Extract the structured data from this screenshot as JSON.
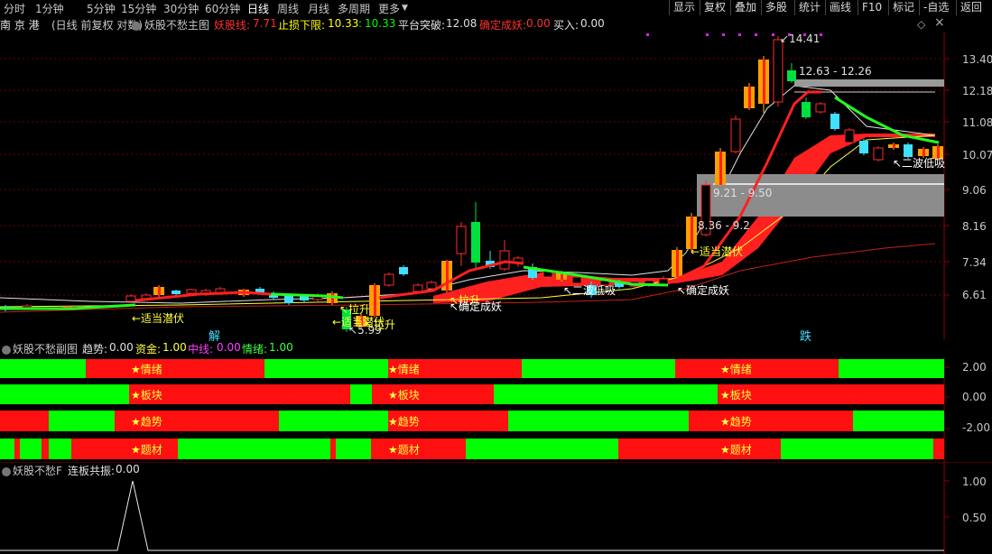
{
  "periods": [
    "分时",
    "1分钟",
    "5分钟",
    "15分钟",
    "30分钟",
    "60分钟",
    "日线",
    "周线",
    "月线",
    "多周期",
    "更多"
  ],
  "active_period": "日线",
  "right_buttons": [
    "显示",
    "复权",
    "叠加",
    "多股",
    "统计",
    "画线",
    "F10",
    "标记",
    "-自选",
    "返回"
  ],
  "stock": {
    "name": "南 京 港",
    "mode": "(日线 前复权 对数)",
    "indicator_main": "妖股不愁主图",
    "yaoguxian_label": "妖股线:",
    "yaoguxian_value": "7.71",
    "stoploss_label": "止损下限:",
    "stoploss_value1": "10.33",
    "stoploss_value2": "10.33",
    "platform_label": "平台突破:",
    "platform_value": "12.08",
    "confirm_label": "确定成妖:",
    "confirm_value": "0.00",
    "buy_label": "买入:",
    "buy_value": "0.00"
  },
  "main_y_labels": [
    "13.40",
    "12.18",
    "11.08",
    "10.07",
    "9.06",
    "8.16",
    "7.34",
    "6.61"
  ],
  "annotations": {
    "high_price": "14.41",
    "range1": "12.63 - 12.26",
    "range2": "9.21 - 9.50",
    "range3": "8.36 - 9.2",
    "low_price": "5.99",
    "sig_latent1": "←适当潜伏",
    "sig_latent2": "←适当潜伏",
    "sig_latent3": "←适当潜伏",
    "sig_pull": "↖拉升",
    "sig_pull2": "↖拉升",
    "sig_confirm1": "↖确定成妖",
    "sig_confirm2": "↖确定成妖",
    "sig_second_wave": "↖二波低吸",
    "sig_second_wave2": "↖二波低吸",
    "marker_jie": "解",
    "marker_die": "跌"
  },
  "sub1": {
    "title": "妖股不愁副图",
    "trend_label": "趋势:",
    "trend_value": "0.00",
    "fund_label": "资金:",
    "fund_value": "1.00",
    "mid_label": "中线:",
    "mid_value": "0.00",
    "mood_label": "情绪:",
    "mood_value": "1.00",
    "y_labels": [
      "2.00",
      "0.00",
      "-2.00"
    ],
    "row_labels": [
      "★情绪",
      "★板块",
      "★趋势",
      "★题材"
    ]
  },
  "sub2": {
    "title": "妖股不愁F",
    "label": "连板共振:",
    "value": "0.00",
    "y_labels": [
      "1.00",
      "0.50"
    ]
  },
  "colors": {
    "up": "#ff2a2a",
    "down": "#00ff00",
    "yellow": "#ffff00",
    "orange": "#ffa500",
    "cyan": "#40e0ff",
    "band_red": "#ff2020",
    "band_green": "#00ff00"
  }
}
